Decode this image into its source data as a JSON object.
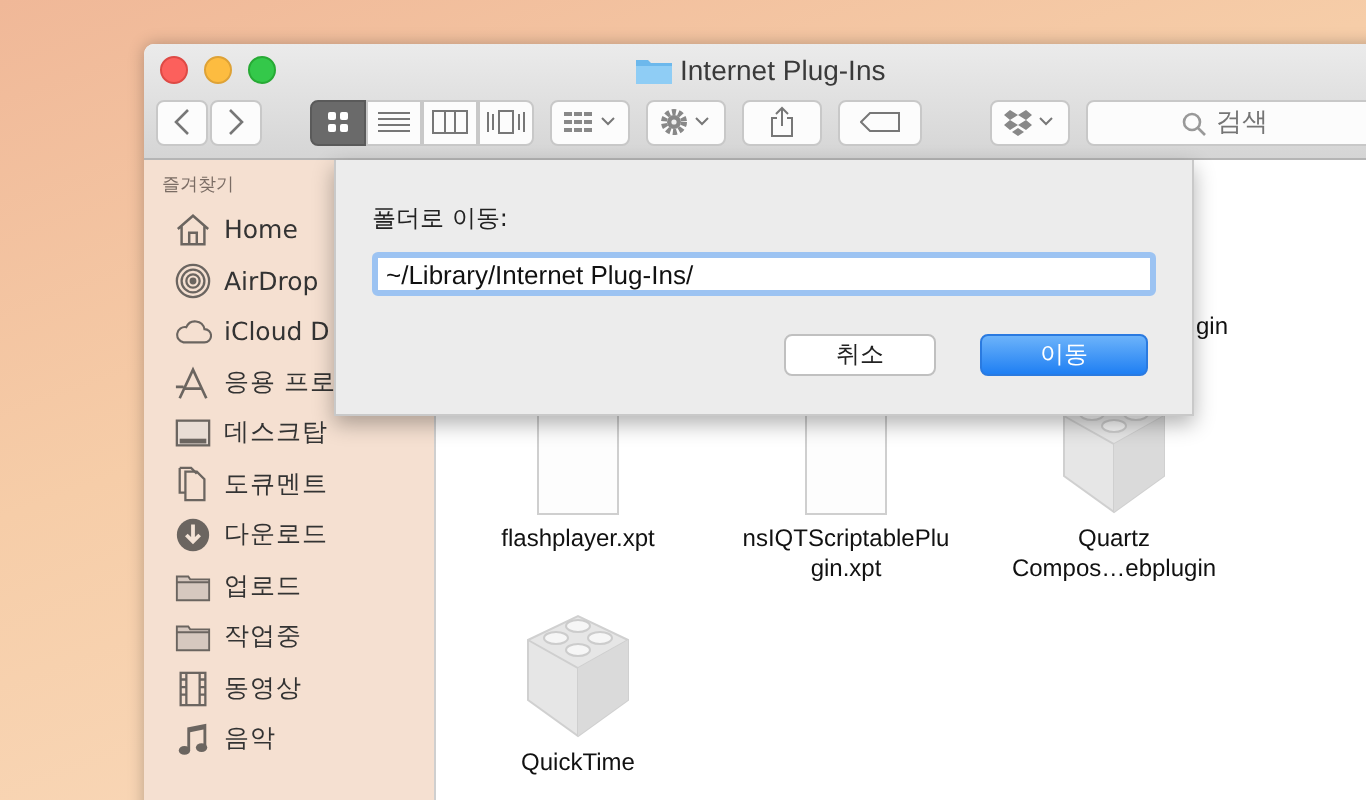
{
  "window": {
    "title": "Internet Plug-Ins"
  },
  "toolbar": {
    "views": [
      {
        "kind": "icon",
        "selected": true
      },
      {
        "kind": "list",
        "selected": false
      },
      {
        "kind": "columns",
        "selected": false
      },
      {
        "kind": "coverflow",
        "selected": false
      }
    ],
    "search": {
      "placeholder": "검색"
    }
  },
  "sidebar": {
    "heading": "즐겨찾기",
    "items": [
      {
        "kind": "home",
        "label": "Home"
      },
      {
        "kind": "airdrop",
        "label": "AirDrop"
      },
      {
        "kind": "cloud",
        "label": "iCloud D"
      },
      {
        "kind": "apps",
        "label": "응용 프로"
      },
      {
        "kind": "desktop",
        "label": "데스크탑"
      },
      {
        "kind": "document",
        "label": "도큐멘트"
      },
      {
        "kind": "download",
        "label": "다운로드"
      },
      {
        "kind": "folder",
        "label": "업로드"
      },
      {
        "kind": "folder",
        "label": "작업중"
      },
      {
        "kind": "film",
        "label": "동영상"
      },
      {
        "kind": "music",
        "label": "음악"
      }
    ]
  },
  "files": {
    "hidden_label_tail": "gin",
    "items": [
      {
        "kind": "document",
        "name_lines": [
          "flashplayer.xpt"
        ]
      },
      {
        "kind": "document",
        "name_lines": [
          "nsIQTScriptablePlu",
          "gin.xpt"
        ]
      },
      {
        "kind": "plugin",
        "name_lines": [
          "Quartz",
          "Compos…ebplugin"
        ]
      },
      {
        "kind": "plugin",
        "name_lines": [
          "QuickTime"
        ]
      }
    ]
  },
  "dialog": {
    "label": "폴더로 이동:",
    "value": "~/Library/Internet Plug-Ins/",
    "buttons": [
      {
        "label": "취소",
        "default": false
      },
      {
        "label": "이동",
        "default": true
      }
    ]
  }
}
